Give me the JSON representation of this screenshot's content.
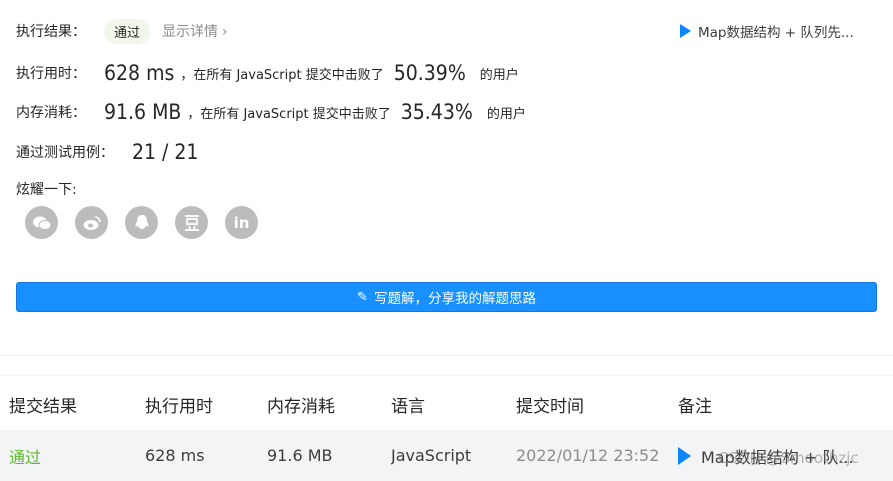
{
  "summary": {
    "result_label": "执行结果：",
    "result_value": "通过",
    "details_link": "显示详情",
    "problem_title": "Map数据结构 + 队列先...",
    "time": {
      "label": "执行用时：",
      "value": "628",
      "unit": "ms",
      "mid_text": "，在所有 JavaScript 提交中击败了",
      "percent": "50.39",
      "pct_sign": "%",
      "tail": "的用户"
    },
    "memory": {
      "label": "内存消耗：",
      "value": "91.6",
      "unit": "MB",
      "mid_text": "，在所有 JavaScript 提交中击败了",
      "percent": "35.43",
      "pct_sign": "%",
      "tail": "的用户"
    },
    "tests": {
      "label": "通过测试用例：",
      "value": "21 / 21"
    },
    "share_label": "炫耀一下:",
    "share_icons": [
      "wechat-icon",
      "weibo-icon",
      "qq-icon",
      "douban-icon",
      "linkedin-icon"
    ],
    "write_button": "写题解，分享我的解题思路"
  },
  "table": {
    "headers": [
      "提交结果",
      "执行用时",
      "内存消耗",
      "语言",
      "提交时间",
      "备注"
    ],
    "rows": [
      [
        "通过",
        "628 ms",
        "91.6 MB",
        "JavaScript",
        "2022/01/12 23:52",
        "Map数据结构 + 队..."
      ]
    ]
  },
  "watermark": "CSDN @Smoothzjc",
  "colors": {
    "accent": "#1890ff",
    "pass_green": "#5cb82f",
    "icon_gray": "#bcbcbc"
  }
}
